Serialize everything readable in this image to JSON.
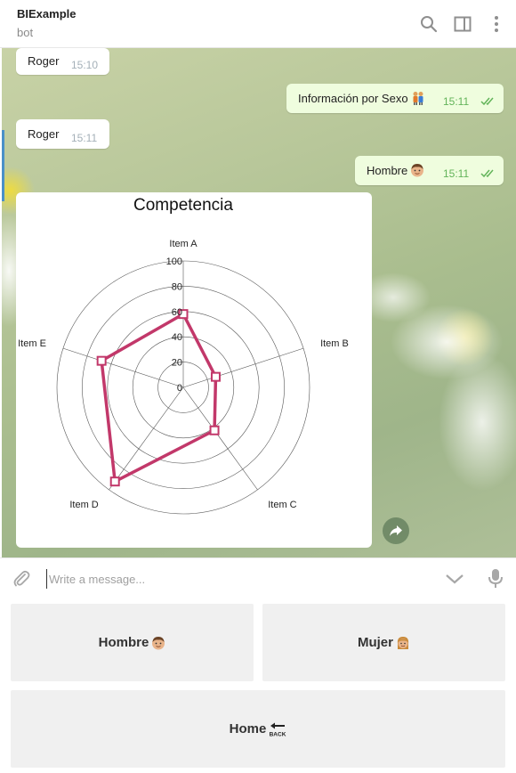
{
  "header": {
    "title": "BIExample",
    "subtitle": "bot"
  },
  "messages": [
    {
      "text": "Roger",
      "time": "15:10",
      "dir": "in"
    },
    {
      "text": "Información por Sexo",
      "emoji": "couple-emoji",
      "time": "15:11",
      "dir": "out"
    },
    {
      "text": "Roger",
      "time": "15:11",
      "dir": "in"
    },
    {
      "text": "Hombre",
      "emoji": "man-emoji",
      "time": "15:11",
      "dir": "out"
    }
  ],
  "chart_data": {
    "type": "radar",
    "title": "Competencia",
    "categories": [
      "Item A",
      "Item B",
      "Item C",
      "Item D",
      "Item E"
    ],
    "values": [
      58,
      27,
      42,
      92,
      68
    ],
    "r_ticks": [
      "0",
      "20",
      "40",
      "60",
      "80",
      "100"
    ],
    "rlim": [
      0,
      100
    ],
    "series_color": "#c2386a",
    "grid": true
  },
  "composer": {
    "placeholder": "Write a message..."
  },
  "keyboard": {
    "rows": [
      [
        {
          "label": "Hombre",
          "emoji": "man-emoji"
        },
        {
          "label": "Mujer",
          "emoji": "woman-emoji"
        }
      ],
      [
        {
          "label": "Home",
          "emoji": "back-arrow-emoji"
        }
      ]
    ]
  },
  "colors": {
    "outgoing_bubble": "#effdde",
    "incoming_bubble": "#ffffff",
    "check_green": "#63b45a",
    "accent_blue": "#4a90c8"
  }
}
